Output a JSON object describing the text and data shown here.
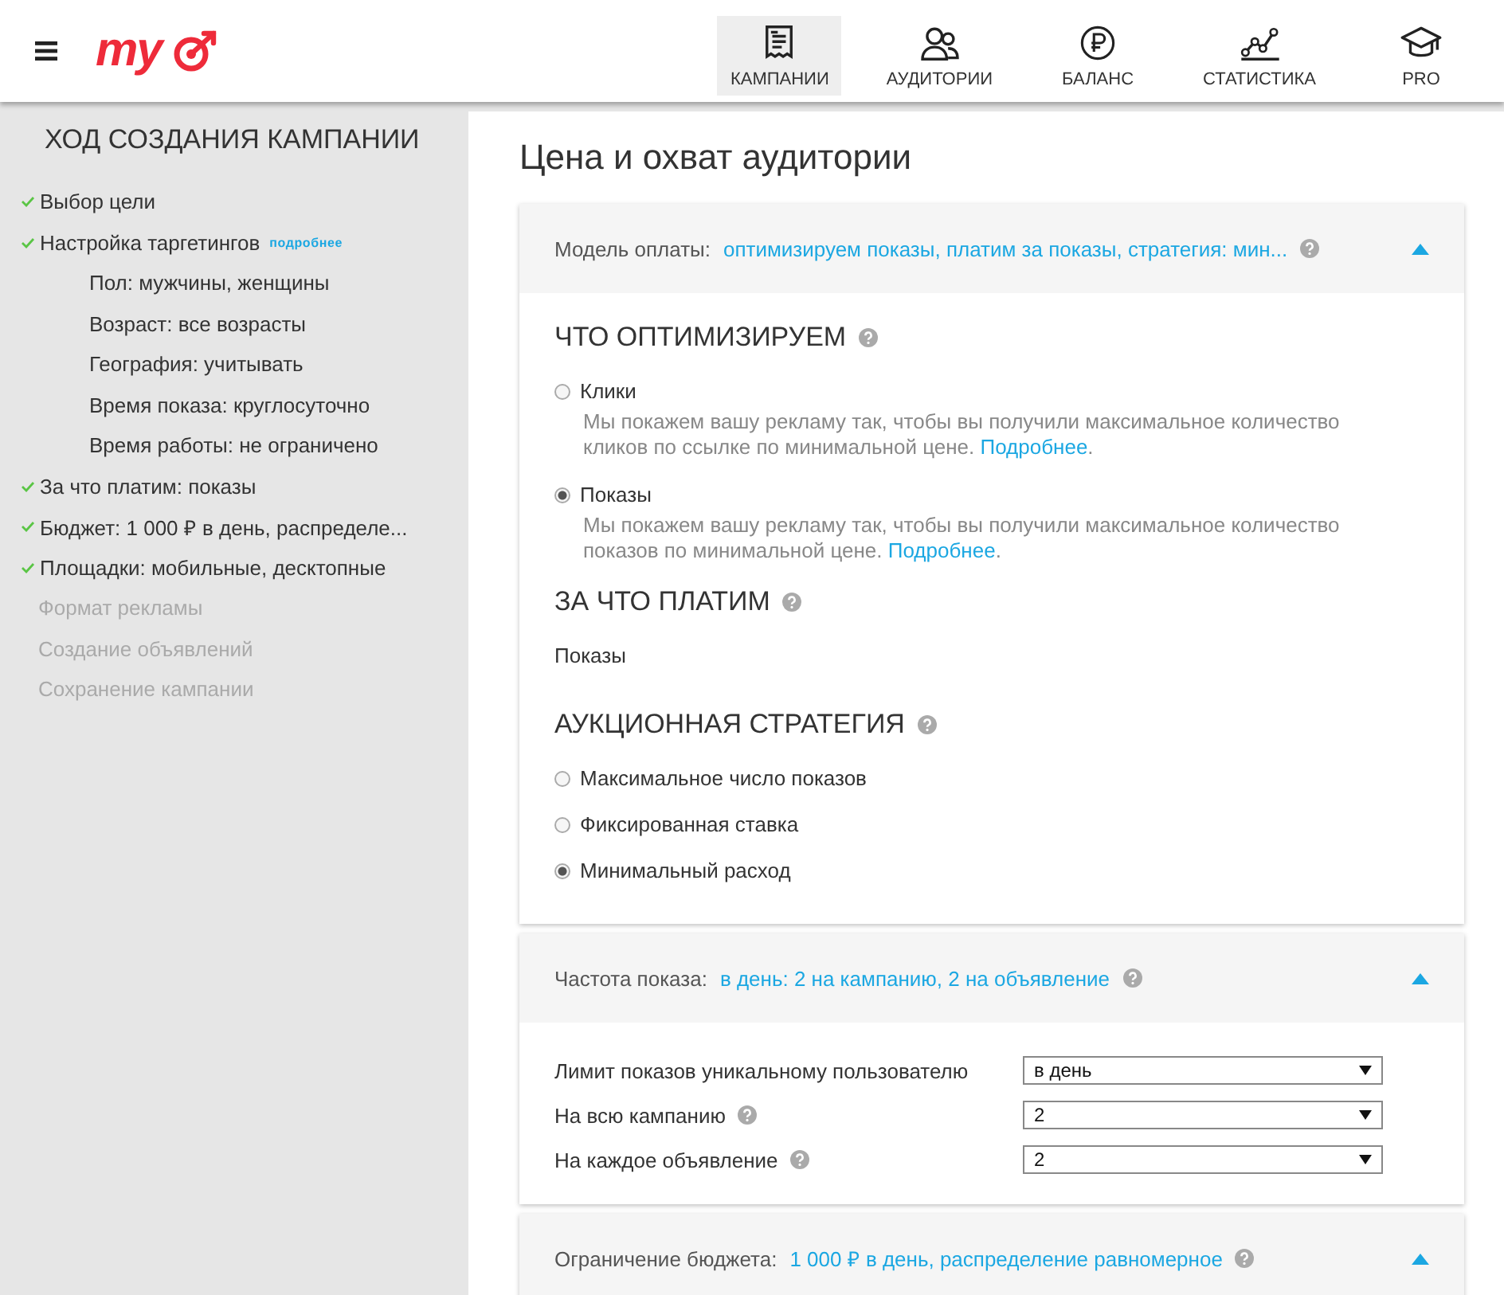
{
  "header": {
    "logo": "my",
    "nav": [
      {
        "label": "КАМПАНИИ",
        "selected": true
      },
      {
        "label": "АУДИТОРИИ",
        "selected": false
      },
      {
        "label": "БАЛАНС",
        "selected": false
      },
      {
        "label": "СТАТИСТИКА",
        "selected": false
      },
      {
        "label": "PRO",
        "selected": false
      }
    ]
  },
  "sidebar": {
    "title": "ХОД СОЗДАНИЯ КАМПАНИИ",
    "steps": [
      {
        "label": "Выбор цели",
        "done": true
      },
      {
        "label": "Настройка таргетингов",
        "done": true,
        "link": "подробнее",
        "children": [
          {
            "label": "Пол: мужчины, женщины"
          },
          {
            "label": "Возраст: все возрасты"
          },
          {
            "label": "География: учитывать"
          },
          {
            "label": "Время показа: круглосуточно"
          },
          {
            "label": "Время работы: не ограничено"
          }
        ]
      },
      {
        "label": "За что платим: показы",
        "done": true
      },
      {
        "label": "Бюджет: 1 000 ₽ в день, распределе...",
        "done": true
      },
      {
        "label": "Площадки: мобильные, десктопные",
        "done": true
      },
      {
        "label": "Формат рекламы",
        "done": false
      },
      {
        "label": "Создание объявлений",
        "done": false
      },
      {
        "label": "Сохранение кампании",
        "done": false
      }
    ]
  },
  "main": {
    "title": "Цена и охват аудитории",
    "sections": [
      {
        "label": "Модель оплаты:",
        "summary": "оптимизируем показы, платим за показы, стратегия: мин...",
        "help": true,
        "expanded": true,
        "groups": [
          {
            "kind": "radio",
            "heading": "ЧТО ОПТИМИЗИРУЕМ",
            "help": true,
            "options": [
              {
                "label": "Клики",
                "selected": false,
                "description": "Мы покажем вашу рекламу так, чтобы вы получили максимальное количество кликов по ссылке по минимальной цене.",
                "link": "Подробнее",
                "after": "."
              },
              {
                "label": "Показы",
                "selected": true,
                "description": "Мы покажем вашу рекламу так, чтобы вы получили максимальное количество показов по минимальной цене.",
                "link": "Подробнее",
                "after": "."
              }
            ]
          },
          {
            "kind": "value",
            "heading": "ЗА ЧТО ПЛАТИМ",
            "help": true,
            "value": "Показы"
          },
          {
            "kind": "radio",
            "heading": "АУКЦИОННАЯ СТРАТЕГИЯ",
            "help": true,
            "options": [
              {
                "label": "Максимальное число показов",
                "selected": false
              },
              {
                "label": "Фиксированная ставка",
                "selected": false
              },
              {
                "label": "Минимальный расход",
                "selected": true
              }
            ]
          }
        ]
      },
      {
        "label": "Частота показа:",
        "summary": "в день: 2 на кампанию, 2 на объявление",
        "help": true,
        "expanded": true,
        "fields": [
          {
            "label": "Лимит показов уникальному пользователю",
            "help": false,
            "value": "в день"
          },
          {
            "label": "На всю кампанию",
            "help": true,
            "value": "2"
          },
          {
            "label": "На каждое объявление",
            "help": true,
            "value": "2"
          }
        ]
      },
      {
        "label": "Ограничение бюджета:",
        "summary": "1 000 ₽ в день, распределение равномерное",
        "help": true,
        "expanded": true
      }
    ]
  }
}
